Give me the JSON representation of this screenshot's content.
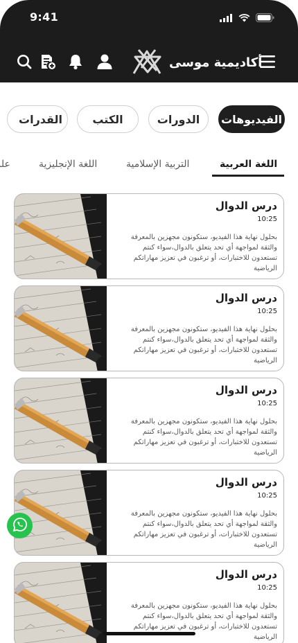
{
  "status": {
    "time": "9:41"
  },
  "header": {
    "brand_name": "أكاديمية موسى",
    "icons": [
      "menu-icon",
      "logo-icon",
      "user-icon",
      "bell-icon",
      "document-add-icon",
      "search-icon"
    ]
  },
  "categories": {
    "items": [
      {
        "label": "الفيديوهات",
        "active": true
      },
      {
        "label": "الدورات",
        "active": false
      },
      {
        "label": "الكتب",
        "active": false
      },
      {
        "label": "القدرات",
        "active": false
      }
    ]
  },
  "subjects": {
    "items": [
      {
        "label": "اللغة العربية",
        "active": true
      },
      {
        "label": "التربية الإسلامية",
        "active": false
      },
      {
        "label": "اللغة الإنجليزية",
        "active": false
      },
      {
        "label": "علوم",
        "active": false
      }
    ]
  },
  "lessons": [
    {
      "title": "درس الدوال",
      "duration": "10:25",
      "description": "بحلول نهاية هذا الفيديو، ستكونون مجهزين بالمعرفة والثقة لمواجهة أي تحد يتعلق بالدوال،سواء كنتم تستعدون للاختبارات، أو ترغبون في تعزيز مهاراتكم الرياضية"
    },
    {
      "title": "درس الدوال",
      "duration": "10:25",
      "description": "بحلول نهاية هذا الفيديو، ستكونون مجهزين بالمعرفة والثقة لمواجهة أي تحد يتعلق بالدوال،سواء كنتم تستعدون للاختبارات، أو ترغبون في تعزيز مهاراتكم الرياضية"
    },
    {
      "title": "درس الدوال",
      "duration": "10:25",
      "description": "بحلول نهاية هذا الفيديو، ستكونون مجهزين بالمعرفة والثقة لمواجهة أي تحد يتعلق بالدوال،سواء كنتم تستعدون للاختبارات، أو ترغبون في تعزيز مهاراتكم الرياضية"
    },
    {
      "title": "درس الدوال",
      "duration": "10:25",
      "description": "بحلول نهاية هذا الفيديو، ستكونون مجهزين بالمعرفة والثقة لمواجهة أي تحد يتعلق بالدوال،سواء كنتم تستعدون للاختبارات، أو ترغبون في تعزيز مهاراتكم الرياضية"
    },
    {
      "title": "درس الدوال",
      "duration": "10:25",
      "description": "بحلول نهاية هذا الفيديو، ستكونون مجهزين بالمعرفة والثقة لمواجهة أي تحد يتعلق بالدوال،سواء كنتم تستعدون للاختبارات، أو ترغبون في تعزيز مهاراتكم الرياضية"
    }
  ],
  "floating": {
    "whatsapp_icon": "whatsapp-icon"
  },
  "colors": {
    "header_bg": "#1c1c1c",
    "active_pill": "#1f1f1f",
    "whatsapp": "#28c24f"
  }
}
